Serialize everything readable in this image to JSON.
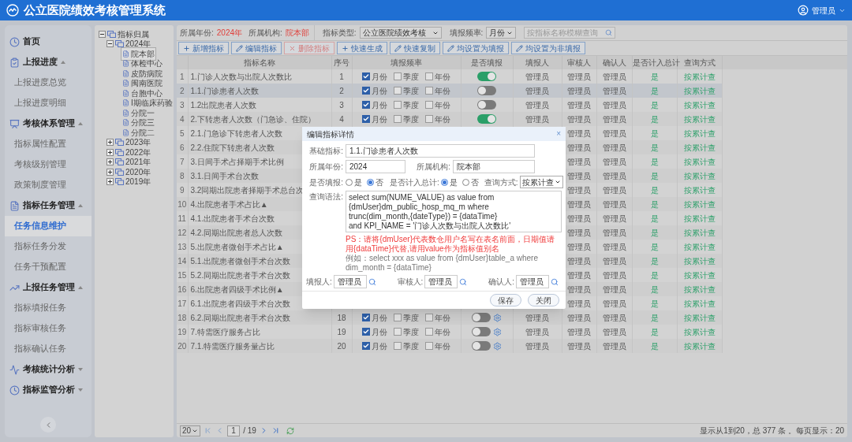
{
  "header": {
    "title": "公立医院绩效考核管理系统",
    "user": "管理员"
  },
  "sidebar": {
    "items": [
      {
        "kind": "link",
        "label": "首页"
      },
      {
        "kind": "group",
        "label": "上报进度",
        "expanded": true,
        "children": [
          {
            "label": "上报进度总览",
            "selected": false
          },
          {
            "label": "上报进度明细",
            "selected": false
          }
        ]
      },
      {
        "kind": "group",
        "label": "考核体系管理",
        "expanded": true,
        "children": [
          {
            "label": "指标属性配置",
            "selected": false
          },
          {
            "label": "考核级别管理",
            "selected": false
          },
          {
            "label": "政策制度管理",
            "selected": false
          }
        ]
      },
      {
        "kind": "group",
        "label": "指标任务管理",
        "expanded": true,
        "children": [
          {
            "label": "任务信息维护",
            "selected": true
          },
          {
            "label": "指标任务分发",
            "selected": false
          },
          {
            "label": "任务干预配置",
            "selected": false
          }
        ]
      },
      {
        "kind": "group",
        "label": "上报任务管理",
        "expanded": true,
        "children": [
          {
            "label": "指标填报任务",
            "selected": false
          },
          {
            "label": "指标审核任务",
            "selected": false
          },
          {
            "label": "指标确认任务",
            "selected": false
          }
        ]
      },
      {
        "kind": "group",
        "label": "考核统计分析",
        "expanded": false
      },
      {
        "kind": "group",
        "label": "指标监管分析",
        "expanded": false
      }
    ]
  },
  "tree": {
    "kind": "folder",
    "label": "指标归属",
    "expanded": true,
    "children": [
      {
        "kind": "folder",
        "label": "2024年",
        "expanded": true,
        "children": [
          {
            "kind": "doc",
            "label": "院本部",
            "selected": true
          },
          {
            "kind": "doc",
            "label": "体检中心",
            "selected": false
          },
          {
            "kind": "doc",
            "label": "皮防病院",
            "selected": false
          },
          {
            "kind": "doc",
            "label": "闽南医院",
            "selected": false
          },
          {
            "kind": "doc",
            "label": "台胞中心",
            "selected": false
          },
          {
            "kind": "doc",
            "label": "I期临床药验",
            "selected": false
          },
          {
            "kind": "doc",
            "label": "分院一",
            "selected": false
          },
          {
            "kind": "doc",
            "label": "分院三",
            "selected": false
          },
          {
            "kind": "doc",
            "label": "分院二",
            "selected": false
          }
        ]
      },
      {
        "kind": "folder",
        "label": "2023年",
        "expanded": false
      },
      {
        "kind": "folder",
        "label": "2022年",
        "expanded": false
      },
      {
        "kind": "folder",
        "label": "2021年",
        "expanded": false
      },
      {
        "kind": "folder",
        "label": "2020年",
        "expanded": false
      },
      {
        "kind": "folder",
        "label": "2019年",
        "expanded": false
      }
    ]
  },
  "filters": {
    "year_label": "所属年份:",
    "year": "2024年",
    "org_label": "所属机构:",
    "org": "院本部",
    "type_label": "指标类型:",
    "type": "公立医院绩效考核",
    "freq_label": "填报频率:",
    "freq": "月份",
    "search_placeholder": "按指标名称模糊查询"
  },
  "toolbar": [
    {
      "kind": "add",
      "label": "新增指标"
    },
    {
      "kind": "edit",
      "label": "编辑指标"
    },
    {
      "kind": "delete",
      "label": "删除指标"
    },
    {
      "kind": "add",
      "label": "快速生成"
    },
    {
      "kind": "edit",
      "label": "快速复制"
    },
    {
      "kind": "edit",
      "label": "均设置为填报"
    },
    {
      "kind": "edit",
      "label": "均设置为非填报"
    }
  ],
  "table": {
    "columns": [
      "指标名称",
      "序号",
      "填报频率",
      "是否填报",
      "填报人",
      "审核人",
      "确认人",
      "是否计入总计",
      "查询方式"
    ],
    "rows": [
      {
        "index": "1",
        "name": "1.门诊人次数与出院人次数比",
        "selected": false,
        "seq": "1",
        "freq": [
          {
            "label": "月份",
            "checked": true
          },
          {
            "label": "季度",
            "checked": false
          },
          {
            "label": "年份",
            "checked": false
          }
        ],
        "report_on": true,
        "settings_icon": false,
        "reporter": "管理员",
        "reviewer": "管理员",
        "confirmer": "管理员",
        "in_total": "是",
        "query": "按累计查"
      },
      {
        "index": "2",
        "name": "1.1.门诊患者人次数",
        "selected": true,
        "seq": "2",
        "freq": [
          {
            "label": "月份",
            "checked": true
          },
          {
            "label": "季度",
            "checked": false
          },
          {
            "label": "年份",
            "checked": false
          }
        ],
        "report_on": false,
        "settings_icon": false,
        "reporter": "管理员",
        "reviewer": "管理员",
        "confirmer": "管理员",
        "in_total": "是",
        "query": "按累计查"
      },
      {
        "index": "3",
        "name": "1.2出院患者人次数",
        "selected": false,
        "seq": "3",
        "freq": [
          {
            "label": "月份",
            "checked": true
          },
          {
            "label": "季度",
            "checked": false
          },
          {
            "label": "年份",
            "checked": false
          }
        ],
        "report_on": false,
        "settings_icon": false,
        "reporter": "管理员",
        "reviewer": "管理员",
        "confirmer": "管理员",
        "in_total": "是",
        "query": "按累计查"
      },
      {
        "index": "4",
        "name": "2.下转患者人次数（门急诊、住院）",
        "selected": false,
        "seq": "4",
        "freq": [
          {
            "label": "月份",
            "checked": true
          },
          {
            "label": "季度",
            "checked": false
          },
          {
            "label": "年份",
            "checked": false
          }
        ],
        "report_on": true,
        "settings_icon": false,
        "reporter": "管理员",
        "reviewer": "管理员",
        "confirmer": "管理员",
        "in_total": "是",
        "query": "按累计查"
      },
      {
        "index": "5",
        "name": "2.1.门急诊下转患者人次数",
        "selected": false,
        "reviewer": "管理员",
        "confirmer": "管理员",
        "in_total": "是",
        "query": "按累计查"
      },
      {
        "index": "6",
        "name": "2.2.住院下转患者人次数",
        "selected": false,
        "reviewer": "管理员",
        "confirmer": "管理员",
        "in_total": "是",
        "query": "按累计查"
      },
      {
        "index": "7",
        "name": "3.日间手术占择期手术比例",
        "selected": false,
        "reviewer": "管理员",
        "confirmer": "管理员",
        "in_total": "是",
        "query": "按累计查"
      },
      {
        "index": "8",
        "name": "3.1.日间手术台次数",
        "selected": false,
        "reviewer": "管理员",
        "confirmer": "管理员",
        "in_total": "是",
        "query": "按累计查"
      },
      {
        "index": "9",
        "name": "3.2同期出院患者择期手术总台次",
        "selected": false,
        "reviewer": "管理员",
        "confirmer": "管理员",
        "in_total": "是",
        "query": "按累计查"
      },
      {
        "index": "10",
        "name": "4.出院患者手术占比▲",
        "selected": false,
        "reviewer": "管理员",
        "confirmer": "管理员",
        "in_total": "是",
        "query": "按累计查"
      },
      {
        "index": "11",
        "name": "4.1.出院患者手术台次数",
        "selected": false,
        "reviewer": "管理员",
        "confirmer": "管理员",
        "in_total": "是",
        "query": "按累计查"
      },
      {
        "index": "12",
        "name": "4.2.同期出院患者总人次数",
        "selected": false,
        "reviewer": "管理员",
        "confirmer": "管理员",
        "in_total": "是",
        "query": "按累计查"
      },
      {
        "index": "13",
        "name": "5.出院患者微创手术占比▲",
        "selected": false,
        "reviewer": "管理员",
        "confirmer": "管理员",
        "in_total": "是",
        "query": "按累计查"
      },
      {
        "index": "14",
        "name": "5.1.出院患者微创手术台次数",
        "selected": false,
        "reviewer": "管理员",
        "confirmer": "管理员",
        "in_total": "是",
        "query": "按累计查"
      },
      {
        "index": "15",
        "name": "5.2.同期出院患者手术台次数",
        "selected": false,
        "reviewer": "管理员",
        "confirmer": "管理员",
        "in_total": "是",
        "query": "按累计查"
      },
      {
        "index": "16",
        "name": "6.出院患者四级手术比例▲",
        "selected": false,
        "reviewer": "管理员",
        "confirmer": "管理员",
        "in_total": "是",
        "query": "按累计查"
      },
      {
        "index": "17",
        "name": "6.1.出院患者四级手术台次数",
        "selected": false,
        "reviewer": "管理员",
        "confirmer": "管理员",
        "in_total": "是",
        "query": "按累计查"
      },
      {
        "index": "18",
        "name": "6.2.同期出院患者手术台次数",
        "selected": false,
        "seq": "18",
        "freq": [
          {
            "label": "月份",
            "checked": true
          },
          {
            "label": "季度",
            "checked": false
          },
          {
            "label": "年份",
            "checked": false
          }
        ],
        "report_on": false,
        "settings_icon": true,
        "reporter": "管理员",
        "reviewer": "管理员",
        "confirmer": "管理员",
        "in_total": "是",
        "query": "按累计查"
      },
      {
        "index": "19",
        "name": "7.特需医疗服务占比",
        "selected": false,
        "seq": "19",
        "freq": [
          {
            "label": "月份",
            "checked": true
          },
          {
            "label": "季度",
            "checked": false
          },
          {
            "label": "年份",
            "checked": false
          }
        ],
        "report_on": false,
        "settings_icon": true,
        "reporter": "管理员",
        "reviewer": "管理员",
        "confirmer": "管理员",
        "in_total": "是",
        "query": "按累计查"
      },
      {
        "index": "20",
        "name": "7.1.特需医疗服务量占比",
        "selected": false,
        "seq": "20",
        "freq": [
          {
            "label": "月份",
            "checked": true
          },
          {
            "label": "季度",
            "checked": false
          },
          {
            "label": "年份",
            "checked": false
          }
        ],
        "report_on": false,
        "settings_icon": true,
        "reporter": "管理员",
        "reviewer": "管理员",
        "confirmer": "管理员",
        "in_total": "是",
        "query": "按累计查"
      }
    ]
  },
  "pager": {
    "page_size": "20",
    "page": "1",
    "total_pages": "/ 19",
    "summary": "显示从1到20，总 377 条 。每页显示：20"
  },
  "dialog": {
    "title": "编辑指标详情",
    "close": "×",
    "base_label": "基础指标:",
    "base": "1.1.门诊患者人次数",
    "year_label": "所属年份:",
    "year": "2024",
    "org_label": "所属机构:",
    "org": "院本部",
    "report_label": "是否填报:",
    "report_options": [
      {
        "label": "是",
        "selected": false
      },
      {
        "label": "否",
        "selected": true
      }
    ],
    "total_label": "是否计入总计:",
    "total_options": [
      {
        "label": "是",
        "selected": true
      },
      {
        "label": "否",
        "selected": false
      }
    ],
    "query_label": "查询方式:",
    "query": "按累计查",
    "sql_label": "查询语法:",
    "sql": "select sum(NUME_VALUE) as value from {dmUser}dm_public_hosp_mq_m where\ntrunc(dim_month,{dateType}) = {dataTime}\nand KPI_NAME = '门诊人次数与出院人次数比'",
    "note": "PS：请将{dmUser}代表数仓用户名写在表名前面，日期值请用{dataTime}代替,请用value作为指标值别名",
    "example": "例如：select xxx as value from {dmUser}table_a where dim_month = {dataTime}",
    "people": [
      {
        "label": "填报人:",
        "value": "管理员"
      },
      {
        "label": "审核人:",
        "value": "管理员"
      },
      {
        "label": "确认人:",
        "value": "管理员"
      }
    ],
    "buttons": [
      "保存",
      "关闭"
    ]
  }
}
